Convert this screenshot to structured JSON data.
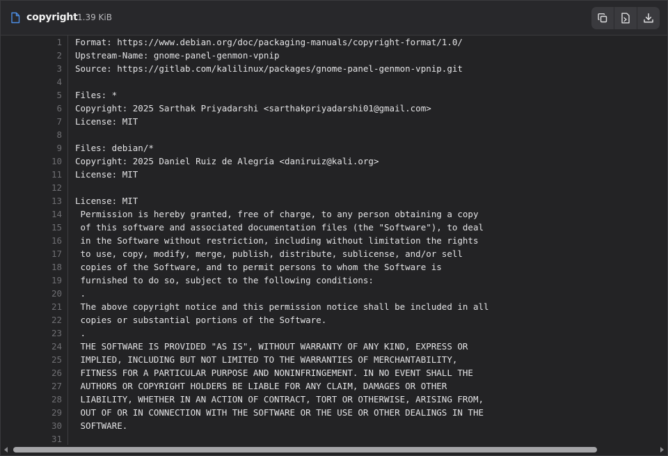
{
  "header": {
    "file_name": "copyright",
    "file_size": "1.39 KiB",
    "buttons": {
      "copy_icon": "copy-icon",
      "raw_icon": "raw-file-icon",
      "download_icon": "download-icon"
    }
  },
  "colors": {
    "accent": "#4d8fe6",
    "background": "#232325",
    "text": "#e4e4e6",
    "line_number": "#6f6f73"
  },
  "lines": [
    {
      "n": "1",
      "text": "Format: https://www.debian.org/doc/packaging-manuals/copyright-format/1.0/"
    },
    {
      "n": "2",
      "text": "Upstream-Name: gnome-panel-genmon-vpnip"
    },
    {
      "n": "3",
      "text": "Source: https://gitlab.com/kalilinux/packages/gnome-panel-genmon-vpnip.git"
    },
    {
      "n": "4",
      "text": ""
    },
    {
      "n": "5",
      "text": "Files: *"
    },
    {
      "n": "6",
      "text": "Copyright: 2025 Sarthak Priyadarshi <sarthakpriyadarshi01@gmail.com>"
    },
    {
      "n": "7",
      "text": "License: MIT"
    },
    {
      "n": "8",
      "text": ""
    },
    {
      "n": "9",
      "text": "Files: debian/*"
    },
    {
      "n": "10",
      "text": "Copyright: 2025 Daniel Ruiz de Alegría <daniruiz@kali.org>"
    },
    {
      "n": "11",
      "text": "License: MIT"
    },
    {
      "n": "12",
      "text": ""
    },
    {
      "n": "13",
      "text": "License: MIT"
    },
    {
      "n": "14",
      "text": " Permission is hereby granted, free of charge, to any person obtaining a copy"
    },
    {
      "n": "15",
      "text": " of this software and associated documentation files (the \"Software\"), to deal"
    },
    {
      "n": "16",
      "text": " in the Software without restriction, including without limitation the rights"
    },
    {
      "n": "17",
      "text": " to use, copy, modify, merge, publish, distribute, sublicense, and/or sell"
    },
    {
      "n": "18",
      "text": " copies of the Software, and to permit persons to whom the Software is"
    },
    {
      "n": "19",
      "text": " furnished to do so, subject to the following conditions:"
    },
    {
      "n": "20",
      "text": " ."
    },
    {
      "n": "21",
      "text": " The above copyright notice and this permission notice shall be included in all"
    },
    {
      "n": "22",
      "text": " copies or substantial portions of the Software."
    },
    {
      "n": "23",
      "text": " ."
    },
    {
      "n": "24",
      "text": " THE SOFTWARE IS PROVIDED \"AS IS\", WITHOUT WARRANTY OF ANY KIND, EXPRESS OR"
    },
    {
      "n": "25",
      "text": " IMPLIED, INCLUDING BUT NOT LIMITED TO THE WARRANTIES OF MERCHANTABILITY,"
    },
    {
      "n": "26",
      "text": " FITNESS FOR A PARTICULAR PURPOSE AND NONINFRINGEMENT. IN NO EVENT SHALL THE"
    },
    {
      "n": "27",
      "text": " AUTHORS OR COPYRIGHT HOLDERS BE LIABLE FOR ANY CLAIM, DAMAGES OR OTHER"
    },
    {
      "n": "28",
      "text": " LIABILITY, WHETHER IN AN ACTION OF CONTRACT, TORT OR OTHERWISE, ARISING FROM,"
    },
    {
      "n": "29",
      "text": " OUT OF OR IN CONNECTION WITH THE SOFTWARE OR THE USE OR OTHER DEALINGS IN THE"
    },
    {
      "n": "30",
      "text": " SOFTWARE."
    },
    {
      "n": "31",
      "text": ""
    }
  ]
}
